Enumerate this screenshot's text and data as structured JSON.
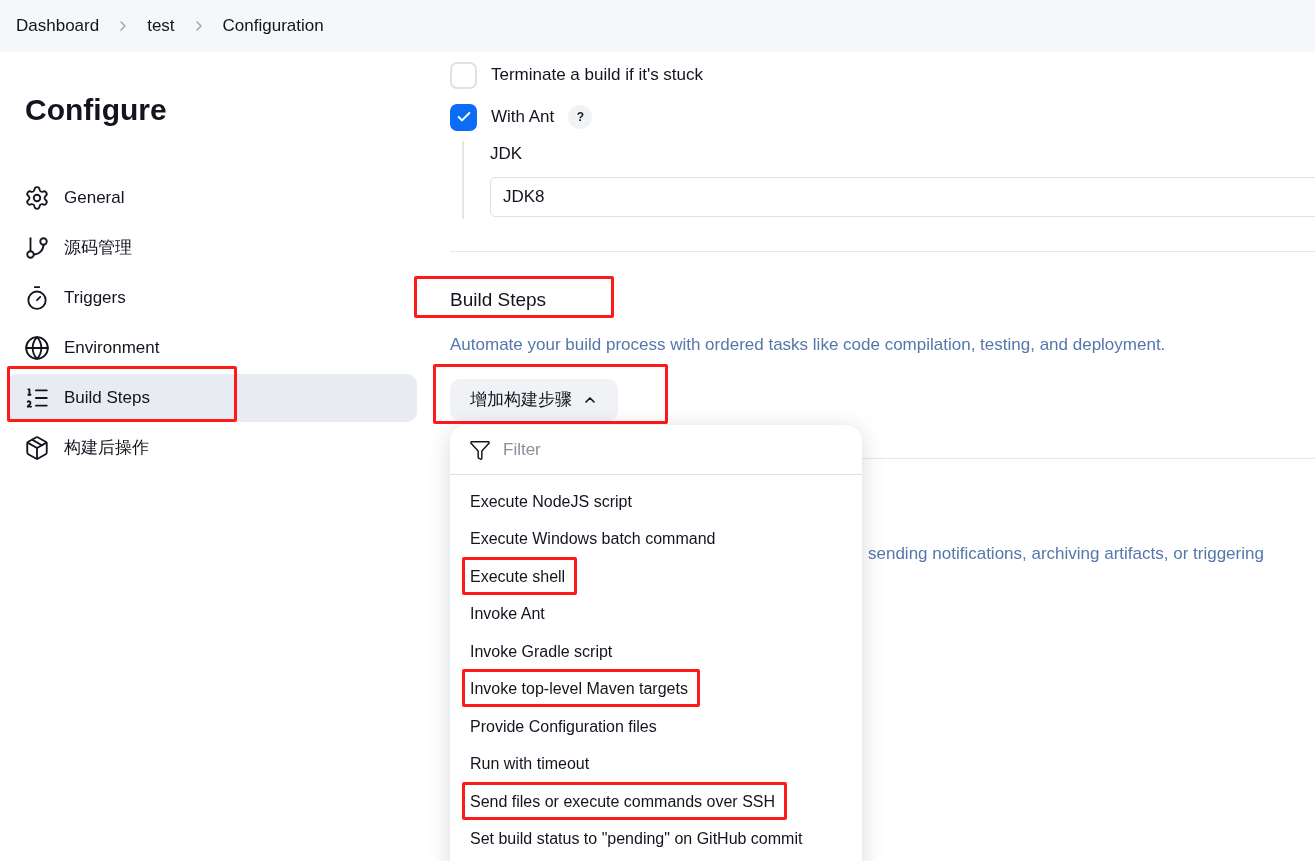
{
  "breadcrumbs": [
    "Dashboard",
    "test",
    "Configuration"
  ],
  "sidebar": {
    "title": "Configure",
    "items": [
      {
        "label": "General",
        "selected": false,
        "highlighted": false
      },
      {
        "label": "源码管理",
        "selected": false,
        "highlighted": false
      },
      {
        "label": "Triggers",
        "selected": false,
        "highlighted": false
      },
      {
        "label": "Environment",
        "selected": false,
        "highlighted": false
      },
      {
        "label": "Build Steps",
        "selected": true,
        "highlighted": true
      },
      {
        "label": "构建后操作",
        "selected": false,
        "highlighted": false
      }
    ]
  },
  "options": [
    {
      "label": "Terminate a build if it's stuck",
      "checked": false
    },
    {
      "label": "With Ant",
      "checked": true,
      "help": "?"
    }
  ],
  "jdk": {
    "label": "JDK",
    "value": "JDK8"
  },
  "build_steps": {
    "title": "Build Steps",
    "highlighted": true,
    "description": "Automate your build process with ordered tasks like code compilation, testing, and deployment.",
    "add_button": {
      "label": "增加构建步骤",
      "expanded": true,
      "highlighted": true
    }
  },
  "menu": {
    "filter_placeholder": "Filter",
    "items": [
      {
        "label": "Execute NodeJS script",
        "highlighted": false
      },
      {
        "label": "Execute Windows batch command",
        "highlighted": false
      },
      {
        "label": "Execute shell",
        "highlighted": true
      },
      {
        "label": "Invoke Ant",
        "highlighted": false
      },
      {
        "label": "Invoke Gradle script",
        "highlighted": false
      },
      {
        "label": "Invoke top-level Maven targets",
        "highlighted": true
      },
      {
        "label": "Provide Configuration files",
        "highlighted": false
      },
      {
        "label": "Run with timeout",
        "highlighted": false
      },
      {
        "label": "Send files or execute commands over SSH",
        "highlighted": true
      },
      {
        "label": "Set build status to \"pending\" on GitHub commit",
        "highlighted": false
      }
    ]
  },
  "post_build": {
    "description": "sending notifications, archiving artifacts, or triggering"
  }
}
